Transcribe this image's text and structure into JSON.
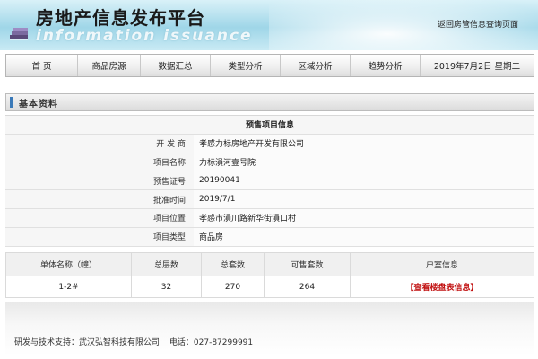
{
  "header": {
    "title": "房地产信息发布平台",
    "subtitle": "information issuance",
    "return_link": "返回房管信息查询页面"
  },
  "nav": {
    "items": [
      "首 页",
      "商品房源",
      "数据汇总",
      "类型分析",
      "区域分析",
      "趋势分析"
    ],
    "date": "2019年7月2日  星期二"
  },
  "section": {
    "title": "基本资料"
  },
  "project": {
    "caption": "预售项目信息",
    "fields": [
      {
        "label": "开 发 商:",
        "value": "孝感力标房地产开发有限公司"
      },
      {
        "label": "项目名称:",
        "value": "力标溳河壹号院"
      },
      {
        "label": "预售证号:",
        "value": "20190041"
      },
      {
        "label": "批准时间:",
        "value": "2019/7/1"
      },
      {
        "label": "项目位置:",
        "value": "孝感市溳川路新华街溳口村"
      },
      {
        "label": "项目类型:",
        "value": "商品房"
      }
    ]
  },
  "units": {
    "headers": [
      "单体名称（幢）",
      "总层数",
      "总套数",
      "可售套数",
      "户室信息"
    ],
    "rows": [
      {
        "name": "1-2#",
        "floors": "32",
        "total": "270",
        "available": "264",
        "link": "【查看楼盘表信息】"
      }
    ]
  },
  "footer": {
    "support": "研发与技术支持：武汉弘智科技有限公司",
    "phone": "电话：027-87299991"
  }
}
